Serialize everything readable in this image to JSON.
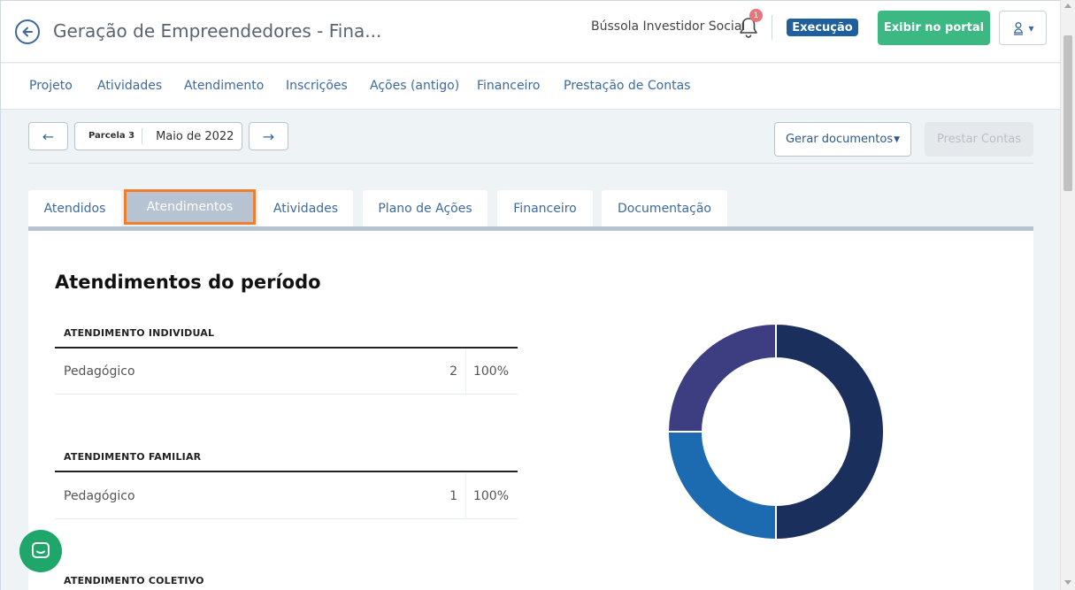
{
  "header": {
    "title": "Geração de Empreendedores - Fina...",
    "org_name": "Bússola Investidor Social",
    "notification_count": "1",
    "status": "Execução",
    "portal_button": "Exibir no portal"
  },
  "nav": {
    "items": [
      "Projeto",
      "Atividades",
      "Atendimento",
      "Inscrições",
      "Ações (antigo)",
      "Financeiro",
      "Prestação de Contas"
    ]
  },
  "period": {
    "prev_arrow": "←",
    "next_arrow": "→",
    "parcela": "Parcela 3",
    "month": "Maio de 2022",
    "generate_docs": "Gerar documentos",
    "render_accounts": "Prestar Contas"
  },
  "tabs": {
    "items": [
      "Atendidos",
      "Atendimentos",
      "Atividades",
      "Plano de Ações",
      "Financeiro",
      "Documentação"
    ],
    "active": "Atendimentos"
  },
  "content": {
    "title": "Atendimentos do período",
    "groups": [
      {
        "header": "ATENDIMENTO INDIVIDUAL",
        "rows": [
          {
            "label": "Pedagógico",
            "count": "2",
            "percent": "100%"
          }
        ]
      },
      {
        "header": "ATENDIMENTO FAMILIAR",
        "rows": [
          {
            "label": "Pedagógico",
            "count": "1",
            "percent": "100%"
          }
        ]
      },
      {
        "header": "ATENDIMENTO COLETIVO",
        "rows": []
      }
    ]
  },
  "chart_data": {
    "type": "pie",
    "values": [
      2,
      1,
      1
    ],
    "colors": [
      "#1b2f5c",
      "#1c6bb0",
      "#3d3d82"
    ]
  },
  "icons": {
    "back": "arrow-left-circle-icon",
    "bell": "bell-icon",
    "user": "user-stamp-icon",
    "chat": "chat-icon"
  }
}
